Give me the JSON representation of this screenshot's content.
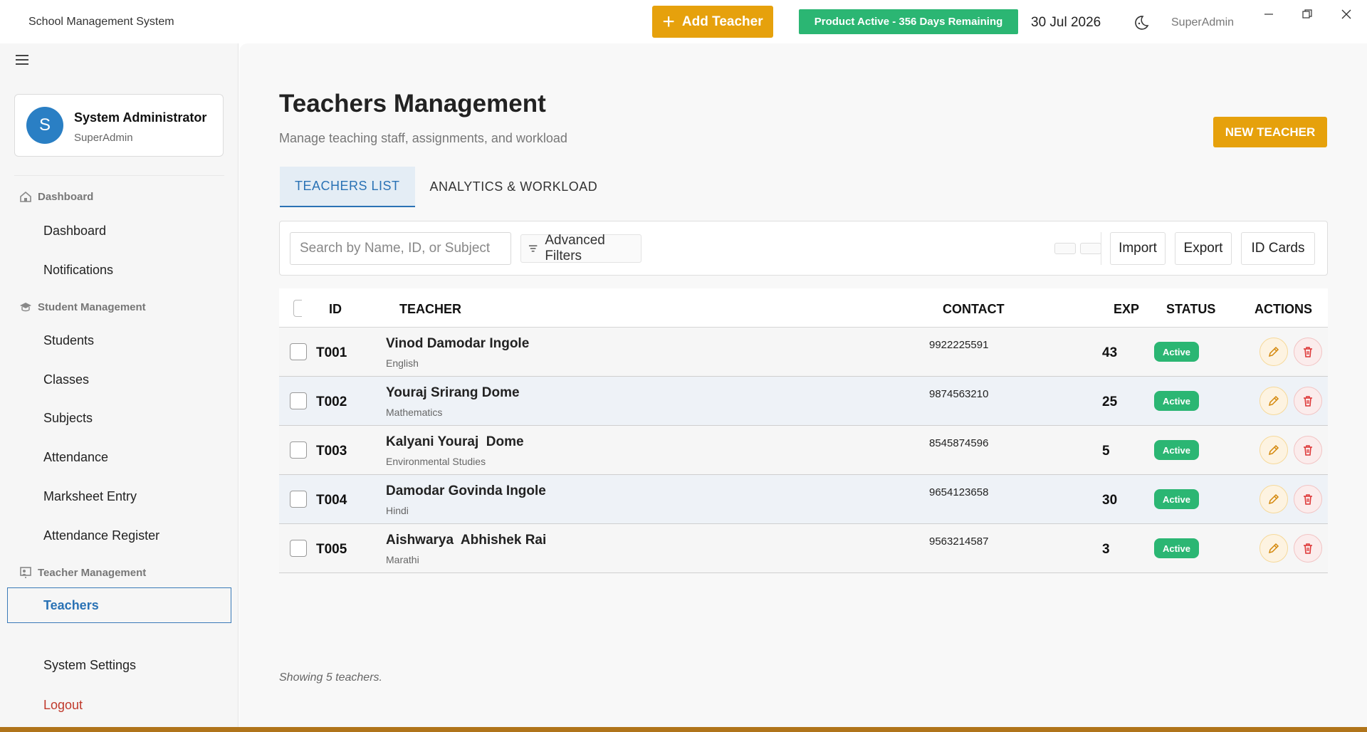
{
  "window": {
    "title": "School Management System"
  },
  "topbar": {
    "add_teacher_label": "Add Teacher",
    "product_status": "Product Active - 356 Days Remaining",
    "date": "30 Jul 2026",
    "user": "SuperAdmin",
    "theme_icon": "moon-icon"
  },
  "sidebar": {
    "profile": {
      "initial": "S",
      "name": "System Administrator",
      "role": "SuperAdmin"
    },
    "sections": {
      "dashboard": "Dashboard",
      "student": "Student Management",
      "teacher": "Teacher Management"
    },
    "items": {
      "dashboard": "Dashboard",
      "notifications": "Notifications",
      "students": "Students",
      "classes": "Classes",
      "subjects": "Subjects",
      "attendance": "Attendance",
      "marksheet": "Marksheet Entry",
      "attendance_register": "Attendance Register",
      "teachers": "Teachers",
      "settings": "System Settings",
      "logout": "Logout"
    }
  },
  "main": {
    "title": "Teachers Management",
    "subtitle": "Manage teaching staff, assignments, and workload",
    "new_teacher_label": "NEW TEACHER",
    "tabs": [
      {
        "label": "TEACHERS LIST",
        "active": true
      },
      {
        "label": "ANALYTICS & WORKLOAD",
        "active": false
      }
    ],
    "toolbar": {
      "search_placeholder": "Search by Name, ID, or Subject",
      "advanced_filters": "Advanced Filters",
      "import": "Import",
      "export": "Export",
      "id_cards": "ID Cards"
    },
    "table": {
      "headers": {
        "id": "ID",
        "teacher": "TEACHER",
        "contact": "CONTACT",
        "exp": "EXP",
        "status": "STATUS",
        "actions": "ACTIONS"
      },
      "rows": [
        {
          "id": "T001",
          "name": "Vinod Damodar Ingole",
          "subject": "English",
          "contact": "9922225591",
          "exp": "43",
          "status": "Active"
        },
        {
          "id": "T002",
          "name": "Youraj Srirang Dome",
          "subject": "Mathematics",
          "contact": "9874563210",
          "exp": "25",
          "status": "Active"
        },
        {
          "id": "T003",
          "name": "Kalyani Youraj  Dome",
          "subject": "Environmental Studies",
          "contact": "8545874596",
          "exp": "5",
          "status": "Active"
        },
        {
          "id": "T004",
          "name": "Damodar Govinda Ingole",
          "subject": "Hindi",
          "contact": "9654123658",
          "exp": "30",
          "status": "Active"
        },
        {
          "id": "T005",
          "name": "Aishwarya  Abhishek Rai",
          "subject": "Marathi",
          "contact": "9563214587",
          "exp": "3",
          "status": "Active"
        }
      ]
    },
    "footer_note": "Showing 5 teachers."
  },
  "colors": {
    "accent": "#e6a10c",
    "success": "#2bb673",
    "primary": "#2a72b5",
    "danger": "#c0392b"
  }
}
